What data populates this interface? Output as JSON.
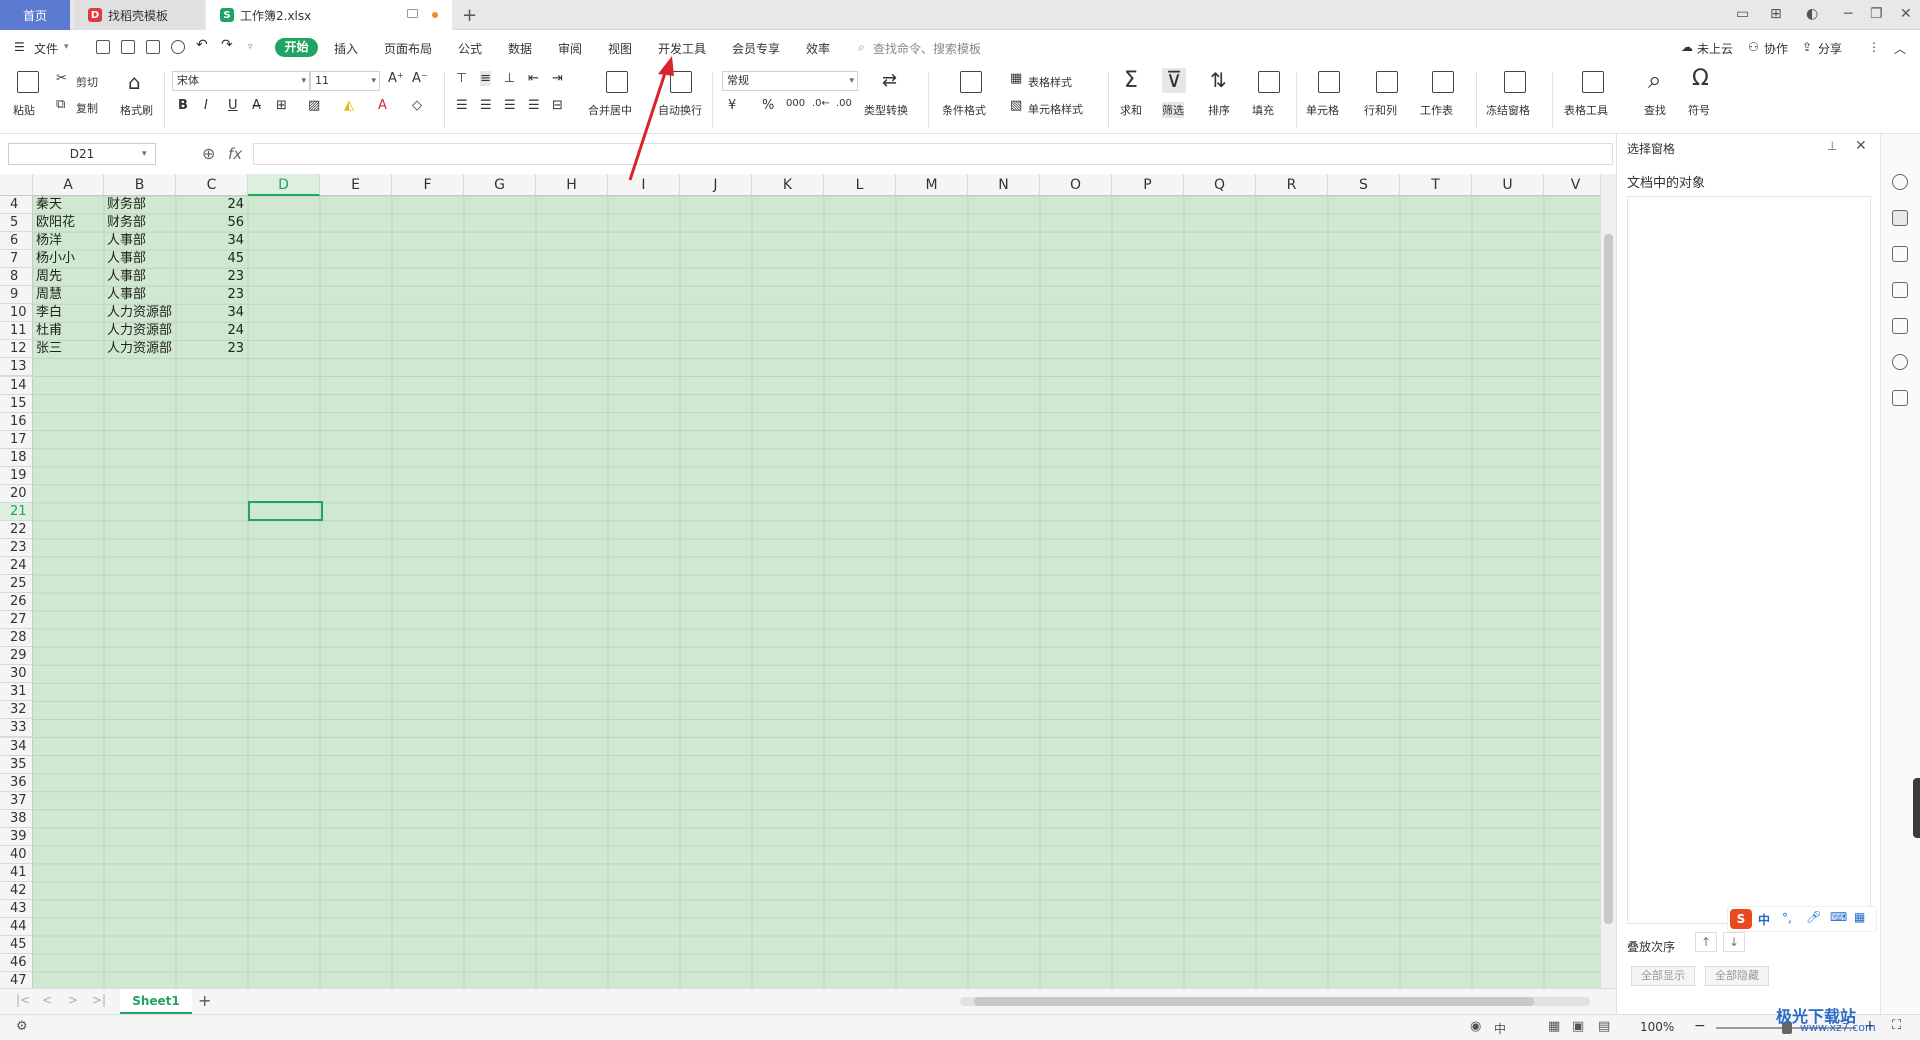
{
  "tabs": {
    "home": "首页",
    "template": "找稻壳模板",
    "doc": "工作簿2.xlsx",
    "new": "+"
  },
  "window_controls": [
    "▭",
    "⊞",
    "◐",
    "─",
    "❐",
    "✕"
  ],
  "menu": {
    "file": "文件",
    "start": "开始",
    "items": [
      "插入",
      "页面布局",
      "公式",
      "数据",
      "审阅",
      "视图",
      "开发工具",
      "会员专享",
      "效率"
    ],
    "search_placeholder": "查找命令、搜索模板",
    "cloud": "未上云",
    "collab": "协作",
    "share": "分享"
  },
  "ribbon": {
    "paste": "粘贴",
    "cut": "剪切",
    "copy": "复制",
    "format_painter": "格式刷",
    "font_name": "宋体",
    "font_size": "11",
    "merge": "合并居中",
    "wrap": "自动换行",
    "number_format": "常规",
    "convert": "类型转换",
    "cond_format": "条件格式",
    "table_style": "表格样式",
    "cell_style": "单元格样式",
    "sum": "求和",
    "filter": "筛选",
    "sort": "排序",
    "fill": "填充",
    "cell": "单元格",
    "rowcol": "行和列",
    "worksheet": "工作表",
    "freeze": "冻结窗格",
    "table_tools": "表格工具",
    "find": "查找",
    "symbol": "符号"
  },
  "formula": {
    "name_box": "D21",
    "fx": "fx",
    "content": ""
  },
  "columns": [
    "A",
    "B",
    "C",
    "D",
    "E",
    "F",
    "G",
    "H",
    "I",
    "J",
    "K",
    "L",
    "M",
    "N",
    "O",
    "P",
    "Q",
    "R",
    "S",
    "T",
    "U",
    "V"
  ],
  "rows": [
    "4",
    "5",
    "6",
    "7",
    "8",
    "9",
    "10",
    "11",
    "12",
    "13",
    "14",
    "15",
    "16",
    "17",
    "18",
    "19",
    "20",
    "21",
    "22",
    "23",
    "24",
    "25",
    "26",
    "27",
    "28",
    "29",
    "30",
    "31",
    "32",
    "33",
    "34",
    "35",
    "36",
    "37",
    "38",
    "39",
    "40",
    "41",
    "42",
    "43",
    "44",
    "45",
    "46",
    "47"
  ],
  "data": [
    {
      "name": "秦天",
      "dept": "财务部",
      "val": "24"
    },
    {
      "name": "欧阳花",
      "dept": "财务部",
      "val": "56"
    },
    {
      "name": "杨洋",
      "dept": "人事部",
      "val": "34"
    },
    {
      "name": "杨小小",
      "dept": "人事部",
      "val": "45"
    },
    {
      "name": "周先",
      "dept": "人事部",
      "val": "23"
    },
    {
      "name": "周慧",
      "dept": "人事部",
      "val": "23"
    },
    {
      "name": "李白",
      "dept": "人力资源部",
      "val": "34"
    },
    {
      "name": "杜甫",
      "dept": "人力资源部",
      "val": "24"
    },
    {
      "name": "张三",
      "dept": "人力资源部",
      "val": "23"
    }
  ],
  "selected_cell": "D21",
  "sheet_tab": "Sheet1",
  "pane": {
    "title": "选择窗格",
    "objects_label": "文档中的对象",
    "order_label": "叠放次序",
    "show_all": "全部显示",
    "hide_all": "全部隐藏"
  },
  "ime": {
    "lang": "中"
  },
  "status": {
    "zoom": "100%",
    "input_mode": "中"
  },
  "watermark": "极光下载站",
  "watermark_url": "www.xz7.com",
  "colors": {
    "accent": "#1fa463",
    "sheet_bg": "#cfe8cf",
    "home_tab": "#5b7bd1",
    "arrow": "#d9232d"
  }
}
